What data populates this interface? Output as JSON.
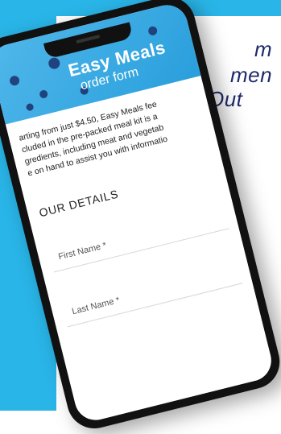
{
  "background": {
    "accent_color": "#29b5e8",
    "text_color": "#1f2a6b",
    "lines": [
      "m",
      "men",
      "Out"
    ]
  },
  "form": {
    "logo_title": "Easy Meals",
    "logo_subtitle": "order form",
    "intro_lines": [
      "arting from just $4.50, Easy Meals fee",
      "cluded in the pre-packed meal kit is a",
      "gredients, including meat and vegetab",
      "e on hand to assist you with informatio"
    ],
    "section_title": "OUR DETAILS",
    "fields": [
      {
        "label": "First Name *"
      },
      {
        "label": "Last Name *"
      }
    ]
  }
}
